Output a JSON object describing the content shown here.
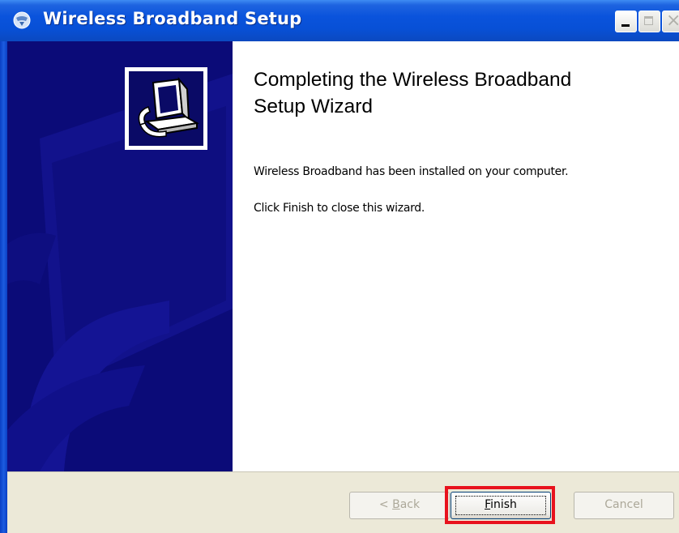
{
  "window": {
    "title": "Wireless Broadband Setup",
    "icon": "setup-globe-icon",
    "controls": [
      "minimize",
      "maximize",
      "close"
    ]
  },
  "wizard": {
    "image_icon": "computer-install-icon",
    "heading_line1": "Completing the Wireless Broadband",
    "heading_line2": "Setup Wizard",
    "message1": "Wireless Broadband has been installed on your computer.",
    "message2": "Click Finish to close this wizard."
  },
  "buttons": {
    "back": {
      "accel": "< ",
      "underlined": "B",
      "rest": "ack",
      "enabled": false
    },
    "finish": {
      "underlined": "F",
      "rest": "inish",
      "enabled": true,
      "highlighted": true
    },
    "cancel": {
      "label": "Cancel",
      "enabled": false
    }
  },
  "colors": {
    "titlebar": "#0a53dc",
    "panel": "#0b0b78",
    "dialog_bg": "#ece9d8",
    "highlight": "#e8121d"
  }
}
